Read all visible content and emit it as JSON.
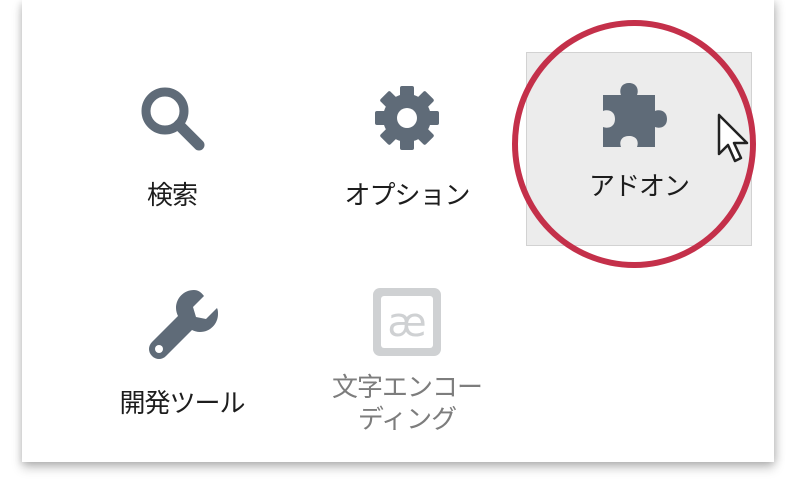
{
  "menu": {
    "items": [
      {
        "label": "検索",
        "icon": "search-icon"
      },
      {
        "label": "オプション",
        "icon": "gear-icon"
      },
      {
        "label": "アドオン",
        "icon": "puzzle-icon",
        "state": "hovered"
      },
      {
        "label": "開発ツール",
        "icon": "wrench-icon"
      },
      {
        "label": "文字エンコーディング",
        "label_lines": [
          "文字エンコー",
          "ディング"
        ],
        "icon": "ae-ligature-icon",
        "state": "disabled"
      }
    ]
  },
  "colors": {
    "icon": "#5f6b78",
    "icon_disabled": "#cfd1d3",
    "highlight": "#c4304a",
    "hover_bg": "#ececec"
  }
}
